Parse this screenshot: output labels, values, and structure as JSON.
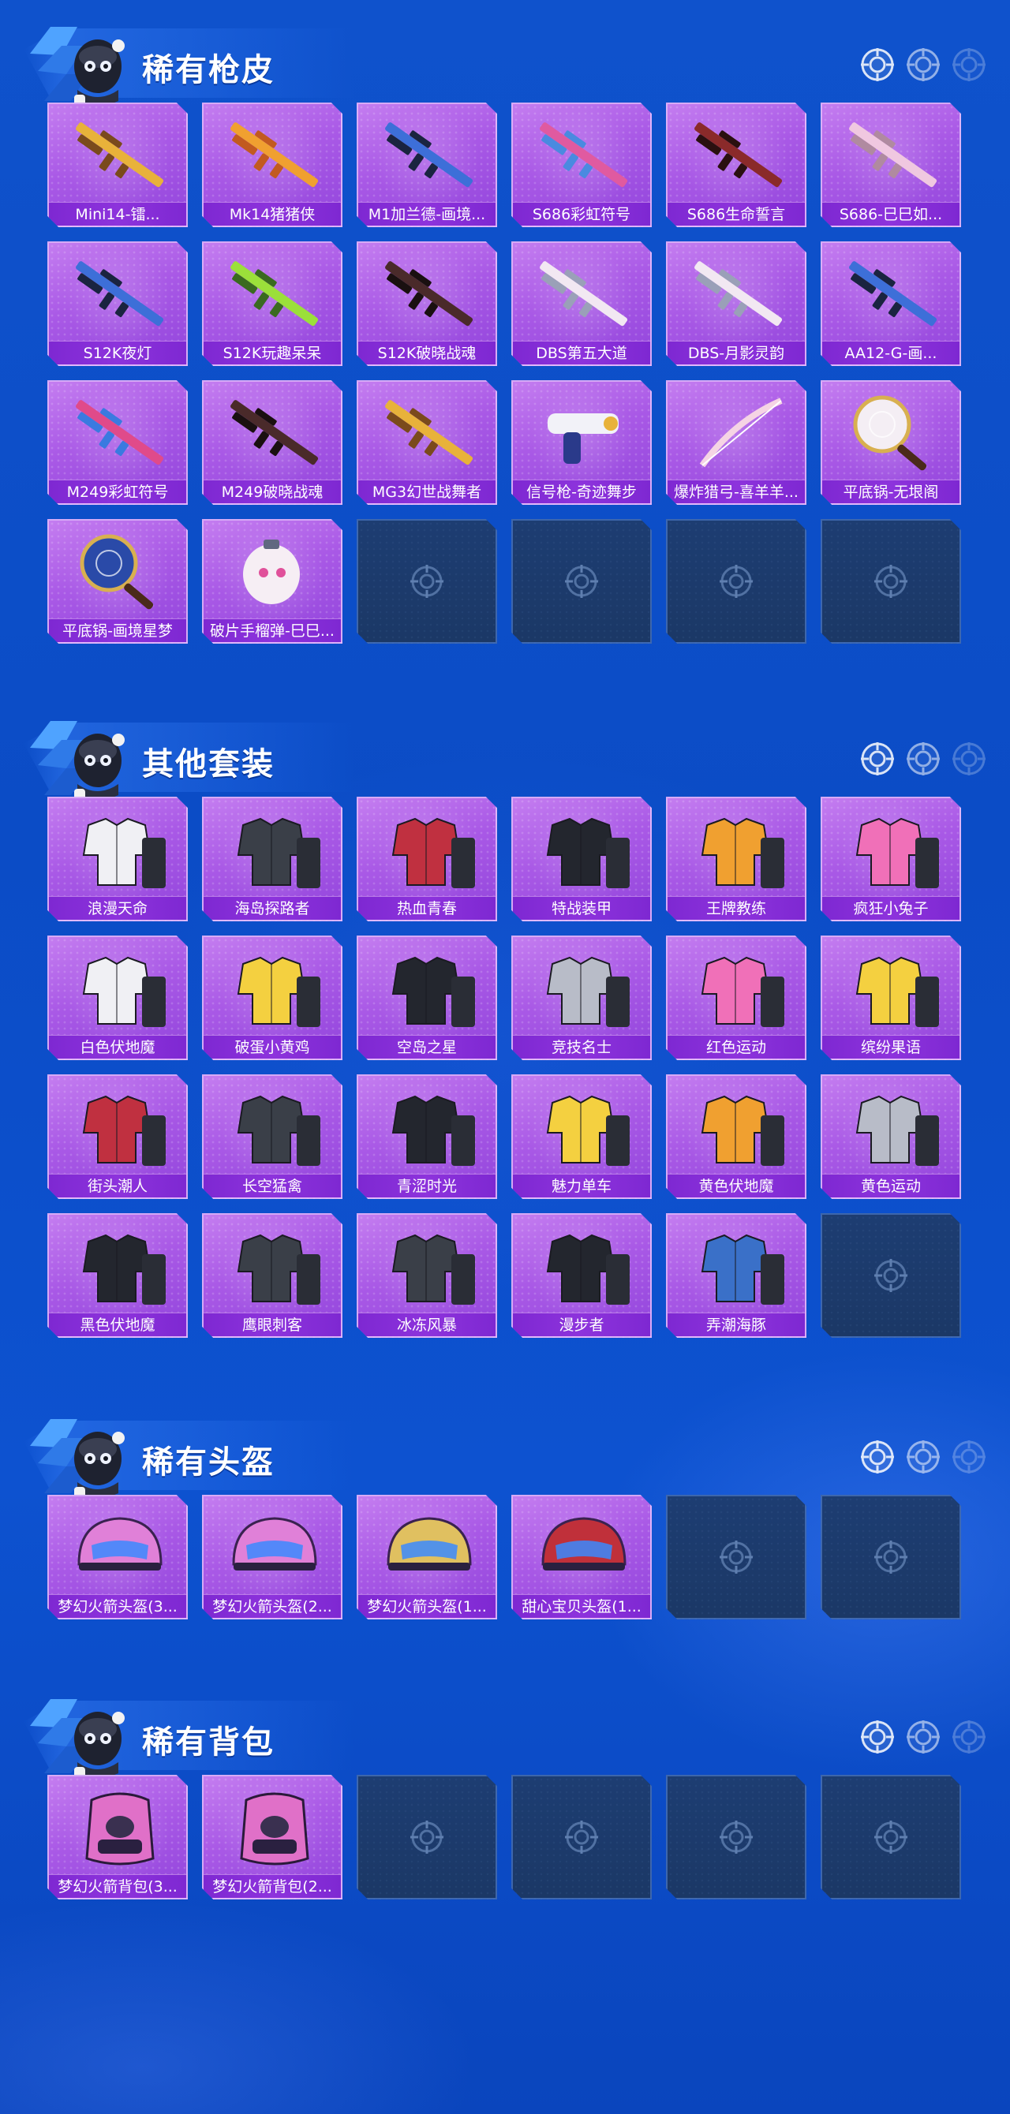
{
  "sections": [
    {
      "title": "稀有枪皮",
      "items": [
        {
          "label": "Mini14-镭...",
          "icon": "rifle-gold"
        },
        {
          "label": "Mk14猪猪侠",
          "icon": "rifle-orange"
        },
        {
          "label": "M1加兰德-画境...",
          "icon": "rifle-blue"
        },
        {
          "label": "S686彩虹符号",
          "icon": "shotgun-rainbow"
        },
        {
          "label": "S686生命誓言",
          "icon": "shotgun-red"
        },
        {
          "label": "S686-巳巳如...",
          "icon": "shotgun-pink"
        },
        {
          "label": "S12K夜灯",
          "icon": "rifle-blue"
        },
        {
          "label": "S12K玩趣呆呆",
          "icon": "rifle-green"
        },
        {
          "label": "S12K破晓战魂",
          "icon": "rifle-dark"
        },
        {
          "label": "DBS第五大道",
          "icon": "gun-white"
        },
        {
          "label": "DBS-月影灵韵",
          "icon": "gun-white"
        },
        {
          "label": "AA12-G-画...",
          "icon": "rifle-blue"
        },
        {
          "label": "M249彩虹符号",
          "icon": "rifle-rainbow"
        },
        {
          "label": "M249破晓战魂",
          "icon": "rifle-dark"
        },
        {
          "label": "MG3幻世战舞者",
          "icon": "rifle-gold"
        },
        {
          "label": "信号枪-奇迹舞步",
          "icon": "flare-gun"
        },
        {
          "label": "爆炸猎弓-喜羊羊...",
          "icon": "bow"
        },
        {
          "label": "平底锅-无垠阁",
          "icon": "pan-white"
        },
        {
          "label": "平底锅-画境星梦",
          "icon": "pan-blue"
        },
        {
          "label": "破片手榴弹-巳巳...",
          "icon": "grenade"
        }
      ],
      "empty_slots": 4
    },
    {
      "title": "其他套装",
      "items": [
        {
          "label": "浪漫天命",
          "icon": "outfit-white"
        },
        {
          "label": "海岛探路者",
          "icon": "outfit-dark"
        },
        {
          "label": "热血青春",
          "icon": "outfit-red"
        },
        {
          "label": "特战装甲",
          "icon": "outfit-black"
        },
        {
          "label": "王牌教练",
          "icon": "outfit-orange"
        },
        {
          "label": "疯狂小兔子",
          "icon": "outfit-pink"
        },
        {
          "label": "白色伏地魔",
          "icon": "outfit-white"
        },
        {
          "label": "破蛋小黄鸡",
          "icon": "outfit-yellow"
        },
        {
          "label": "空岛之星",
          "icon": "outfit-black"
        },
        {
          "label": "竞技名士",
          "icon": "outfit-gray"
        },
        {
          "label": "红色运动",
          "icon": "outfit-pink"
        },
        {
          "label": "缤纷果语",
          "icon": "outfit-yellow"
        },
        {
          "label": "街头潮人",
          "icon": "outfit-red"
        },
        {
          "label": "长空猛禽",
          "icon": "outfit-dark"
        },
        {
          "label": "青涩时光",
          "icon": "outfit-black"
        },
        {
          "label": "魅力单车",
          "icon": "outfit-yellow"
        },
        {
          "label": "黄色伏地魔",
          "icon": "outfit-orange"
        },
        {
          "label": "黄色运动",
          "icon": "outfit-gray"
        },
        {
          "label": "黑色伏地魔",
          "icon": "outfit-black"
        },
        {
          "label": "鹰眼刺客",
          "icon": "outfit-dark"
        },
        {
          "label": "冰冻风暴",
          "icon": "outfit-dark"
        },
        {
          "label": "漫步者",
          "icon": "outfit-black"
        },
        {
          "label": "弄潮海豚",
          "icon": "outfit-blue"
        }
      ],
      "empty_slots": 1
    },
    {
      "title": "稀有头盔",
      "items": [
        {
          "label": "梦幻火箭头盔(3...",
          "icon": "helmet-pink"
        },
        {
          "label": "梦幻火箭头盔(2...",
          "icon": "helmet-pink"
        },
        {
          "label": "梦幻火箭头盔(1...",
          "icon": "helmet-small"
        },
        {
          "label": "甜心宝贝头盔(1...",
          "icon": "helmet-red"
        }
      ],
      "empty_slots": 2
    },
    {
      "title": "稀有背包",
      "items": [
        {
          "label": "梦幻火箭背包(3...",
          "icon": "backpack-pink"
        },
        {
          "label": "梦幻火箭背包(2...",
          "icon": "backpack-pink"
        }
      ],
      "empty_slots": 4
    }
  ],
  "colors": {
    "background": "#0b4cc6",
    "slot_filled": "#a959e6",
    "slot_label": "#8d33dc",
    "slot_empty": "#1d3d72"
  }
}
